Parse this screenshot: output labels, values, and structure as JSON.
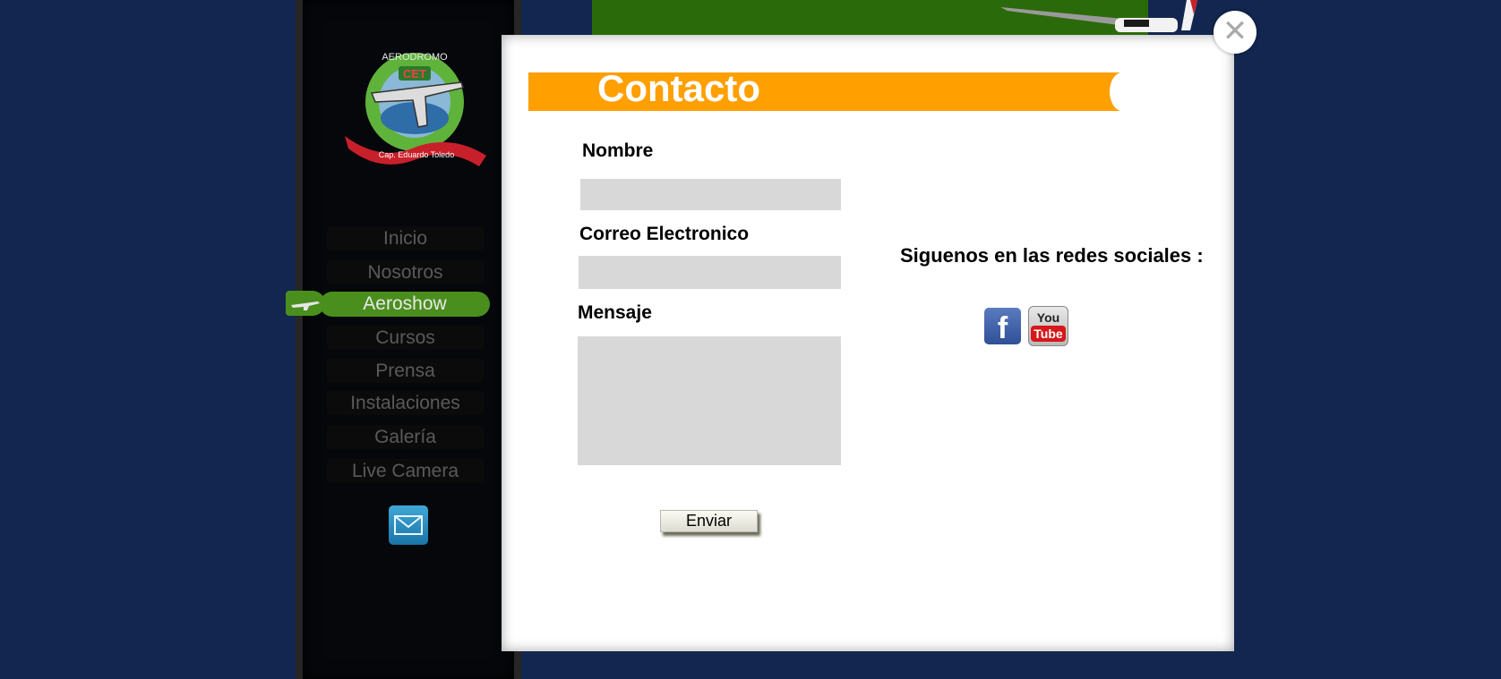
{
  "sidebar": {
    "logo": {
      "top_text": "AERODROMO",
      "badge": "CET",
      "ribbon": "Cap. Eduardo Toledo"
    },
    "nav": [
      {
        "label": "Inicio",
        "active": false
      },
      {
        "label": "Nosotros",
        "active": false
      },
      {
        "label": "Aeroshow",
        "active": true
      },
      {
        "label": "Cursos",
        "active": false
      },
      {
        "label": "Prensa",
        "active": false
      },
      {
        "label": "Instalaciones",
        "active": false
      },
      {
        "label": "Galería",
        "active": false
      },
      {
        "label": "Live Camera",
        "active": false
      }
    ],
    "mail_icon": "envelope-icon"
  },
  "modal": {
    "title": "Contacto",
    "close_icon": "close-icon",
    "form": {
      "name_label": "Nombre",
      "name_value": "",
      "email_label": "Correo Electronico",
      "email_value": "",
      "message_label": "Mensaje",
      "message_value": "",
      "submit_label": "Enviar"
    },
    "social": {
      "label": "Siguenos en las redes sociales :",
      "facebook_glyph": "f",
      "youtube_you": "You",
      "youtube_tube": "Tube"
    }
  },
  "colors": {
    "page_bg": "#13264f",
    "title_bar": "#ff9f00",
    "nav_active": "#4a8f1e",
    "field_bg": "#d8d8d8"
  }
}
